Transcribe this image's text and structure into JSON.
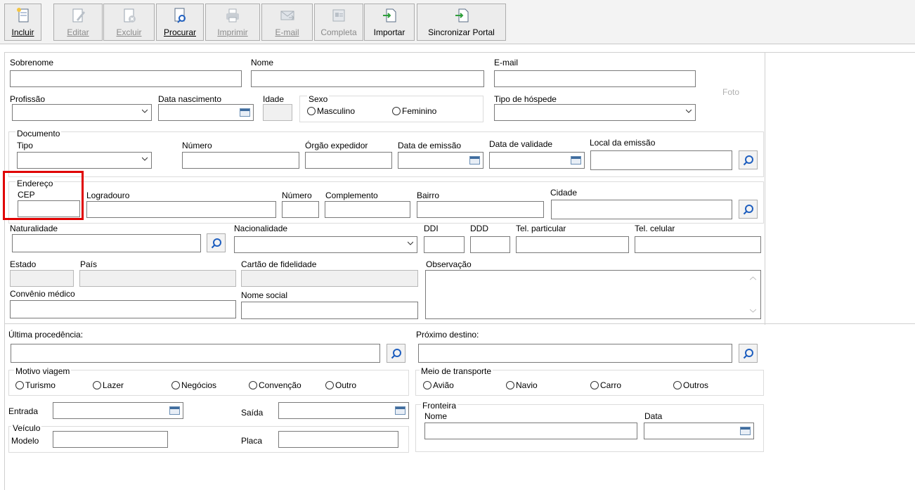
{
  "toolbar": {
    "incluir": "Incluir",
    "editar": "Editar",
    "excluir": "Excluir",
    "procurar": "Procurar",
    "imprimir": "Imprimir",
    "email": "E-mail",
    "completa": "Completa",
    "importar": "Importar",
    "sincronizar": "Sincronizar Portal"
  },
  "personal": {
    "sobrenome": "Sobrenome",
    "nome": "Nome",
    "email": "E-mail",
    "foto": "Foto",
    "profissao": "Profissão",
    "data_nascimento": "Data nascimento",
    "idade": "Idade",
    "sexo": "Sexo",
    "masculino": "Masculino",
    "feminino": "Feminino",
    "tipo_hospede": "Tipo de hóspede"
  },
  "documento": {
    "group": "Documento",
    "tipo": "Tipo",
    "numero": "Número",
    "orgao": "Órgão expedidor",
    "data_emissao": "Data de emissão",
    "data_validade": "Data de validade",
    "local_emissao": "Local da emissão"
  },
  "endereco": {
    "group": "Endereço",
    "cep": "CEP",
    "logradouro": "Logradouro",
    "numero": "Número",
    "complemento": "Complemento",
    "bairro": "Bairro",
    "cidade": "Cidade"
  },
  "contato": {
    "naturalidade": "Naturalidade",
    "nacionalidade": "Nacionalidade",
    "ddi": "DDI",
    "ddd": "DDD",
    "tel_particular": "Tel. particular",
    "tel_celular": "Tel. celular",
    "estado": "Estado",
    "pais": "País",
    "cartao": "Cartão de fidelidade",
    "observacao": "Observação",
    "convenio": "Convênio médico",
    "nome_social": "Nome social"
  },
  "viagem": {
    "ultima": "Última procedência:",
    "proximo": "Próximo destino:",
    "motivo": "Motivo viagem",
    "motivos": [
      "Turismo",
      "Lazer",
      "Negócios",
      "Convenção",
      "Outro"
    ],
    "meio": "Meio de transporte",
    "meios": [
      "Avião",
      "Navio",
      "Carro",
      "Outros"
    ],
    "entrada": "Entrada",
    "saida": "Saída",
    "fronteira": "Fronteira",
    "fronteira_nome": "Nome",
    "fronteira_data": "Data",
    "veiculo": "Veículo",
    "modelo": "Modelo",
    "placa": "Placa"
  },
  "colors": {
    "highlight": "#e00000",
    "search_icon": "#1f5fbf"
  }
}
